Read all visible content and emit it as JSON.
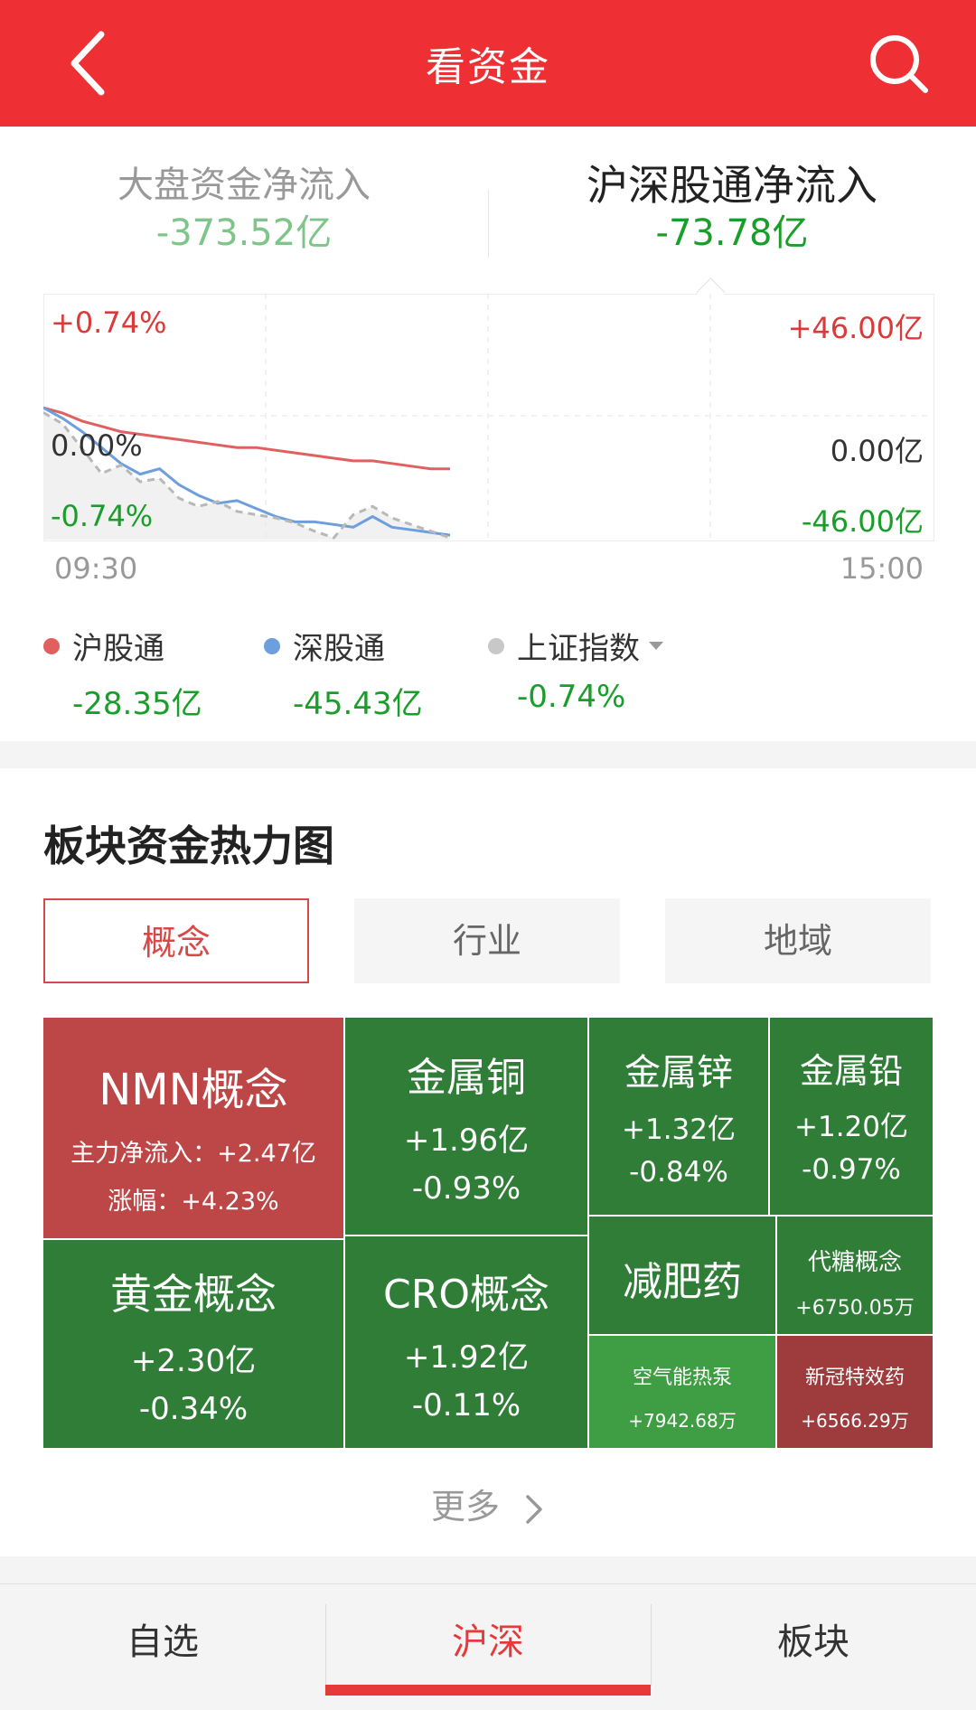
{
  "header": {
    "title": "看资金"
  },
  "summary": {
    "market": {
      "label": "大盘资金净流入",
      "value": "-373.52亿"
    },
    "connect": {
      "label": "沪深股通净流入",
      "value": "-73.78亿"
    }
  },
  "chart": {
    "left_top": "+0.74%",
    "left_mid": "0.00%",
    "left_bottom": "-0.74%",
    "right_top": "+46.00亿",
    "right_mid": "0.00亿",
    "right_bottom": "-46.00亿",
    "time_start": "09:30",
    "time_end": "15:00"
  },
  "chart_data": {
    "type": "line",
    "x_range": [
      "09:30",
      "15:00"
    ],
    "y_left_range": [
      -0.74,
      0.74
    ],
    "y_right_range": [
      -46.0,
      46.0
    ],
    "series": [
      {
        "name": "沪股通",
        "color": "#e06060",
        "axis": "right",
        "values": [
          3,
          1,
          -2,
          -4,
          -6,
          -7,
          -8,
          -9,
          -10,
          -11,
          -12,
          -12,
          -13,
          -14,
          -15,
          -16,
          -17,
          -17,
          -18,
          -19,
          -20,
          -20
        ]
      },
      {
        "name": "深股通",
        "color": "#6d9fdc",
        "axis": "right",
        "values": [
          3,
          -1,
          -6,
          -12,
          -18,
          -22,
          -20,
          -26,
          -30,
          -33,
          -32,
          -35,
          -38,
          -40,
          -40,
          -41,
          -42,
          -38,
          -42,
          -43,
          -44,
          -45
        ]
      },
      {
        "name": "上证指数",
        "color": "#b8b8b8",
        "axis": "left",
        "values": [
          0.02,
          -0.05,
          -0.2,
          -0.35,
          -0.3,
          -0.4,
          -0.38,
          -0.5,
          -0.55,
          -0.52,
          -0.58,
          -0.6,
          -0.62,
          -0.65,
          -0.7,
          -0.74,
          -0.6,
          -0.55,
          -0.62,
          -0.66,
          -0.7,
          -0.74
        ]
      }
    ]
  },
  "legend": [
    {
      "name": "沪股通",
      "value": "-28.35亿",
      "color": "#e06060"
    },
    {
      "name": "深股通",
      "value": "-45.43亿",
      "color": "#6d9fdc"
    },
    {
      "name": "上证指数",
      "value": "-0.74%",
      "color": "#c8c8c8"
    }
  ],
  "heatmap": {
    "title": "板块资金热力图",
    "tabs": [
      "概念",
      "行业",
      "地域"
    ],
    "cells": {
      "nmn": {
        "name": "NMN概念",
        "inflow": "主力净流入：+2.47亿",
        "change": "涨幅：+4.23%"
      },
      "copper": {
        "name": "金属铜",
        "inflow": "+1.96亿",
        "change": "-0.93%"
      },
      "zinc": {
        "name": "金属锌",
        "inflow": "+1.32亿",
        "change": "-0.84%"
      },
      "lead": {
        "name": "金属铅",
        "inflow": "+1.20亿",
        "change": "-0.97%"
      },
      "gold": {
        "name": "黄金概念",
        "inflow": "+2.30亿",
        "change": "-0.34%"
      },
      "cro": {
        "name": "CRO概念",
        "inflow": "+1.92亿",
        "change": "-0.11%"
      },
      "diet": {
        "name": "减肥药"
      },
      "sugar": {
        "name": "代糖概念",
        "inflow": "+6750.05万"
      },
      "heatpump": {
        "name": "空气能热泵",
        "inflow": "+7942.68万"
      },
      "covid": {
        "name": "新冠特效药",
        "inflow": "+6566.29万"
      }
    },
    "more": "更多"
  },
  "bottom_nav": [
    "自选",
    "沪深",
    "板块"
  ]
}
